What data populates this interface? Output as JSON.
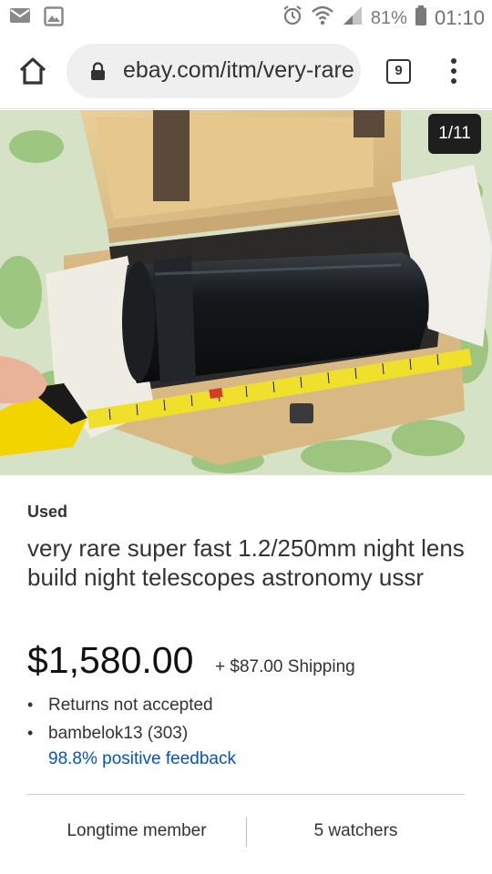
{
  "status_bar": {
    "battery": "81%",
    "time": "01:10"
  },
  "browser": {
    "url": "ebay.com/itm/very-rare",
    "tab_count": "9"
  },
  "gallery": {
    "counter": "1/11"
  },
  "listing": {
    "condition": "Used",
    "title": "very rare super fast 1.2/250mm night lens  build night telescopes astronomy ussr",
    "price": "$1,580.00",
    "shipping": "+ $87.00 Shipping",
    "returns": "Returns not accepted",
    "seller": "bambelok13 (303)",
    "feedback": "98.8% positive feedback",
    "seller_tenure": "Longtime member",
    "watchers": "5 watchers"
  },
  "colors": {
    "link": "#0654ba",
    "counter_bg": "#1e1e1e",
    "url_pill": "#efefef"
  }
}
